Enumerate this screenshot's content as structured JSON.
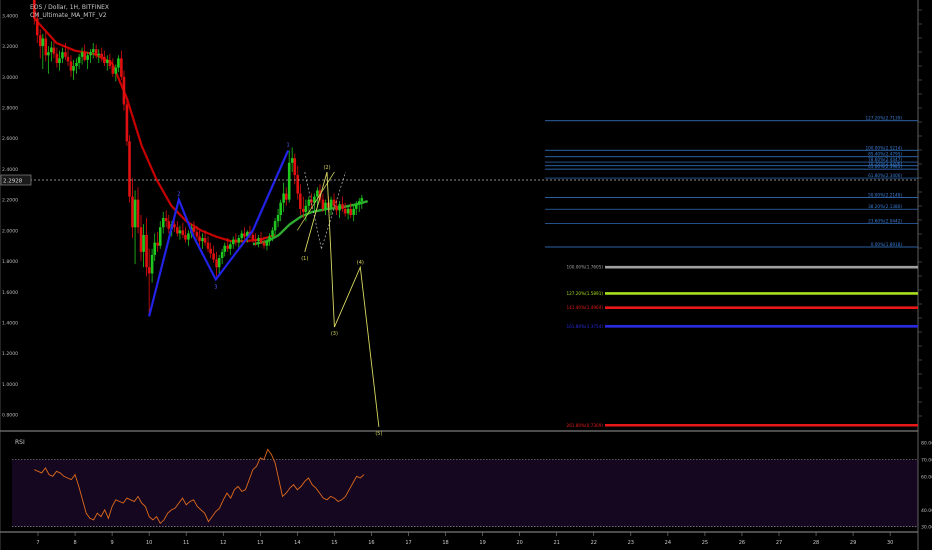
{
  "legend": {
    "line1": "EOS / Dollar, 1H, BITFINEX",
    "line2": "CM_Ultimate_MA_MTF_V2"
  },
  "rsi_label": "RSI",
  "price_tag": "2.2928",
  "colors": {
    "background": "#000000",
    "up_candle": "#1ec81e",
    "down_candle": "#e01010",
    "ma_red": "#c80000",
    "ma_green": "#2eaa2e",
    "pattern": "#2222e8",
    "wave": "#d8d860",
    "fib_line": "#3a7fd8",
    "rsi_line": "#e06a1a",
    "rsi_band": "#160720"
  },
  "chart_data": [
    {
      "type": "candlestick",
      "name": "EOS / Dollar, 1H",
      "y_axis_ticks": [
        "3.4000",
        "3.2000",
        "3.0000",
        "2.8000",
        "2.6000",
        "2.4000",
        "2.2000",
        "2.0000",
        "1.8000",
        "1.6000",
        "1.4000",
        "1.2000",
        "1.0000",
        "0.8000"
      ],
      "ylim": [
        0.7,
        3.5
      ],
      "x_axis_ticks": [
        "7",
        "8",
        "9",
        "10",
        "11",
        "12",
        "13",
        "14",
        "15",
        "16",
        "17",
        "18",
        "19",
        "20",
        "21",
        "22",
        "23",
        "24",
        "25",
        "26",
        "27",
        "28",
        "29",
        "30"
      ],
      "candles": [
        [
          6.9,
          3.5,
          3.52,
          3.34,
          3.38
        ],
        [
          6.98,
          3.38,
          3.42,
          3.22,
          3.27
        ],
        [
          7.06,
          3.27,
          3.31,
          3.12,
          3.2
        ],
        [
          7.13,
          3.2,
          3.28,
          3.05,
          3.25
        ],
        [
          7.21,
          3.25,
          3.29,
          3.1,
          3.14
        ],
        [
          7.28,
          3.14,
          3.2,
          3.02,
          3.16
        ],
        [
          7.36,
          3.16,
          3.23,
          3.1,
          3.19
        ],
        [
          7.43,
          3.19,
          3.23,
          3.12,
          3.15
        ],
        [
          7.51,
          3.15,
          3.19,
          3.06,
          3.09
        ],
        [
          7.58,
          3.09,
          3.17,
          3.04,
          3.12
        ],
        [
          7.66,
          3.12,
          3.19,
          3.09,
          3.16
        ],
        [
          7.74,
          3.16,
          3.22,
          3.11,
          3.13
        ],
        [
          7.81,
          3.13,
          3.18,
          3.07,
          3.1
        ],
        [
          7.89,
          3.1,
          3.14,
          3.0,
          3.04
        ],
        [
          7.96,
          3.04,
          3.11,
          2.98,
          3.07
        ],
        [
          8.04,
          3.07,
          3.12,
          3.02,
          3.09
        ],
        [
          8.11,
          3.09,
          3.15,
          3.05,
          3.13
        ],
        [
          8.19,
          3.13,
          3.19,
          3.08,
          3.16
        ],
        [
          8.26,
          3.16,
          3.21,
          3.1,
          3.11
        ],
        [
          8.34,
          3.11,
          3.16,
          3.05,
          3.14
        ],
        [
          8.42,
          3.14,
          3.18,
          3.09,
          3.16
        ],
        [
          8.49,
          3.16,
          3.22,
          3.12,
          3.18
        ],
        [
          8.57,
          3.18,
          3.21,
          3.12,
          3.14
        ],
        [
          8.64,
          3.14,
          3.18,
          3.09,
          3.15
        ],
        [
          8.72,
          3.15,
          3.19,
          3.1,
          3.13
        ],
        [
          8.79,
          3.13,
          3.17,
          3.07,
          3.09
        ],
        [
          8.87,
          3.09,
          3.14,
          3.04,
          3.11
        ],
        [
          8.94,
          3.11,
          3.15,
          3.05,
          3.07
        ],
        [
          9.02,
          3.07,
          3.12,
          3.0,
          3.02
        ],
        [
          9.1,
          3.02,
          3.08,
          2.97,
          3.06
        ],
        [
          9.17,
          3.06,
          3.14,
          3.03,
          3.12
        ],
        [
          9.25,
          3.12,
          3.17,
          2.98,
          3.0
        ],
        [
          9.32,
          3.0,
          3.04,
          2.78,
          2.82
        ],
        [
          9.4,
          2.82,
          2.86,
          2.55,
          2.58
        ],
        [
          9.47,
          2.58,
          2.62,
          2.18,
          2.22
        ],
        [
          9.55,
          2.22,
          2.34,
          1.95,
          2.02
        ],
        [
          9.62,
          2.02,
          2.26,
          1.78,
          2.2
        ],
        [
          9.7,
          2.2,
          2.28,
          1.98,
          2.02
        ],
        [
          9.78,
          2.02,
          2.1,
          1.8,
          1.86
        ],
        [
          9.85,
          1.86,
          2.04,
          1.76,
          1.97
        ],
        [
          9.93,
          1.97,
          2.08,
          1.7,
          1.76
        ],
        [
          10.0,
          1.76,
          1.88,
          1.44,
          1.72
        ],
        [
          10.08,
          1.72,
          1.88,
          1.66,
          1.84
        ],
        [
          10.15,
          1.84,
          1.98,
          1.8,
          1.92
        ],
        [
          10.23,
          1.92,
          1.99,
          1.86,
          1.9
        ],
        [
          10.3,
          1.9,
          2.06,
          1.88,
          2.02
        ],
        [
          10.38,
          2.02,
          2.12,
          1.98,
          2.08
        ],
        [
          10.46,
          2.08,
          2.13,
          2.02,
          2.06
        ],
        [
          10.53,
          2.06,
          2.1,
          1.98,
          2.01
        ],
        [
          10.61,
          2.01,
          2.06,
          1.96,
          2.04
        ],
        [
          10.68,
          2.04,
          2.08,
          1.99,
          2.02
        ],
        [
          10.76,
          2.02,
          2.06,
          1.96,
          1.98
        ],
        [
          10.83,
          1.98,
          2.03,
          1.94,
          2.0
        ],
        [
          10.91,
          2.0,
          2.05,
          1.95,
          1.97
        ],
        [
          10.98,
          1.97,
          2.02,
          1.92,
          1.94
        ],
        [
          11.06,
          1.94,
          2.0,
          1.9,
          1.98
        ],
        [
          11.14,
          1.98,
          2.04,
          1.95,
          2.02
        ],
        [
          11.21,
          2.02,
          2.06,
          1.97,
          1.99
        ],
        [
          11.29,
          1.99,
          2.03,
          1.94,
          1.96
        ],
        [
          11.36,
          1.96,
          2.0,
          1.9,
          1.93
        ],
        [
          11.44,
          1.93,
          1.98,
          1.88,
          1.95
        ],
        [
          11.51,
          1.95,
          2.0,
          1.9,
          1.92
        ],
        [
          11.59,
          1.92,
          1.96,
          1.86,
          1.88
        ],
        [
          11.66,
          1.88,
          1.92,
          1.82,
          1.85
        ],
        [
          11.74,
          1.85,
          1.9,
          1.79,
          1.81
        ],
        [
          11.82,
          1.81,
          1.86,
          1.7,
          1.76
        ],
        [
          11.89,
          1.76,
          1.84,
          1.72,
          1.82
        ],
        [
          11.97,
          1.82,
          1.88,
          1.78,
          1.86
        ],
        [
          12.04,
          1.86,
          1.92,
          1.83,
          1.9
        ],
        [
          12.12,
          1.9,
          1.95,
          1.86,
          1.88
        ],
        [
          12.19,
          1.88,
          1.93,
          1.84,
          1.91
        ],
        [
          12.27,
          1.91,
          1.96,
          1.88,
          1.94
        ],
        [
          12.34,
          1.94,
          1.98,
          1.9,
          1.92
        ],
        [
          12.42,
          1.92,
          1.97,
          1.88,
          1.95
        ],
        [
          12.5,
          1.95,
          2.0,
          1.92,
          1.98
        ],
        [
          12.57,
          1.98,
          2.02,
          1.94,
          1.96
        ],
        [
          12.65,
          1.96,
          2.0,
          1.92,
          1.99
        ],
        [
          12.72,
          1.99,
          2.03,
          1.95,
          1.97
        ],
        [
          12.8,
          1.97,
          2.01,
          1.92,
          1.94
        ],
        [
          12.87,
          1.94,
          1.98,
          1.9,
          1.93
        ],
        [
          12.95,
          1.93,
          1.97,
          1.89,
          1.95
        ],
        [
          13.02,
          1.95,
          1.99,
          1.91,
          1.92
        ],
        [
          13.1,
          1.92,
          1.96,
          1.88,
          1.9
        ],
        [
          13.18,
          1.9,
          1.95,
          1.87,
          1.93
        ],
        [
          13.25,
          1.93,
          1.98,
          1.9,
          1.96
        ],
        [
          13.33,
          1.96,
          2.02,
          1.93,
          2.0
        ],
        [
          13.4,
          2.0,
          2.08,
          1.97,
          2.06
        ],
        [
          13.48,
          2.06,
          2.14,
          2.02,
          2.1
        ],
        [
          13.55,
          2.1,
          2.2,
          2.06,
          2.18
        ],
        [
          13.63,
          2.18,
          2.31,
          2.12,
          2.24
        ],
        [
          13.7,
          2.24,
          2.28,
          2.16,
          2.2
        ],
        [
          13.78,
          2.2,
          2.52,
          2.18,
          2.44
        ],
        [
          13.86,
          2.44,
          2.54,
          2.38,
          2.47
        ],
        [
          13.93,
          2.47,
          2.5,
          2.3,
          2.36
        ],
        [
          14.01,
          2.36,
          2.42,
          2.2,
          2.24
        ],
        [
          14.08,
          2.24,
          2.3,
          2.1,
          2.14
        ],
        [
          14.16,
          2.14,
          2.22,
          2.08,
          2.12
        ],
        [
          14.23,
          2.12,
          2.2,
          2.06,
          2.16
        ],
        [
          14.31,
          2.16,
          2.22,
          2.12,
          2.2
        ],
        [
          14.38,
          2.2,
          2.24,
          2.14,
          2.18
        ],
        [
          14.46,
          2.18,
          2.24,
          2.12,
          2.22
        ],
        [
          14.54,
          2.22,
          2.28,
          2.16,
          2.26
        ],
        [
          14.61,
          2.26,
          2.3,
          2.18,
          2.2
        ],
        [
          14.69,
          2.2,
          2.24,
          2.12,
          2.14
        ],
        [
          14.76,
          2.14,
          2.2,
          2.1,
          2.18
        ],
        [
          14.84,
          2.18,
          2.22,
          2.12,
          2.15
        ],
        [
          14.91,
          2.15,
          2.22,
          2.1,
          2.2
        ],
        [
          14.99,
          2.2,
          2.24,
          2.14,
          2.16
        ],
        [
          15.06,
          2.16,
          2.2,
          2.1,
          2.13
        ],
        [
          15.14,
          2.13,
          2.19,
          2.08,
          2.17
        ],
        [
          15.22,
          2.17,
          2.22,
          2.12,
          2.14
        ],
        [
          15.29,
          2.14,
          2.18,
          2.09,
          2.11
        ],
        [
          15.37,
          2.11,
          2.16,
          2.07,
          2.14
        ],
        [
          15.44,
          2.14,
          2.18,
          2.08,
          2.1
        ],
        [
          15.52,
          2.1,
          2.16,
          2.06,
          2.14
        ],
        [
          15.59,
          2.14,
          2.19,
          2.1,
          2.17
        ],
        [
          15.67,
          2.17,
          2.21,
          2.12,
          2.19
        ],
        [
          15.74,
          2.19,
          2.23,
          2.14,
          2.21
        ]
      ],
      "ma_red": [
        [
          6.9,
          3.38
        ],
        [
          7.5,
          3.22
        ],
        [
          8.0,
          3.17
        ],
        [
          8.5,
          3.15
        ],
        [
          9.0,
          3.09
        ],
        [
          9.4,
          2.86
        ],
        [
          9.8,
          2.55
        ],
        [
          10.2,
          2.33
        ],
        [
          10.6,
          2.16
        ],
        [
          11.0,
          2.06
        ],
        [
          11.4,
          2.0
        ],
        [
          11.8,
          1.96
        ],
        [
          12.2,
          1.93
        ],
        [
          12.6,
          1.93
        ],
        [
          13.0,
          1.94
        ],
        [
          13.4,
          1.97
        ]
      ],
      "ma_green": [
        [
          12.8,
          1.91
        ],
        [
          13.2,
          1.93
        ],
        [
          13.5,
          1.97
        ],
        [
          13.8,
          2.04
        ],
        [
          14.1,
          2.09
        ],
        [
          14.4,
          2.12
        ],
        [
          14.8,
          2.14
        ],
        [
          15.2,
          2.15
        ],
        [
          15.6,
          2.17
        ],
        [
          15.9,
          2.19
        ]
      ],
      "pattern_points": [
        [
          10.0,
          1.44,
          ""
        ],
        [
          10.8,
          2.2,
          "2"
        ],
        [
          11.2,
          1.96,
          ""
        ],
        [
          11.8,
          1.68,
          "3"
        ],
        [
          12.8,
          2.0,
          ""
        ],
        [
          13.75,
          2.52,
          "1"
        ]
      ],
      "fib_levels": [
        {
          "label": "127.20%(2.7139)",
          "value": 2.7139
        },
        {
          "label": "100.00%(2.5214)",
          "value": 2.5214
        },
        {
          "label": "85.40%(2.4795)",
          "value": 2.4795
        },
        {
          "label": "78.60%(2.4447)",
          "value": 2.4447
        },
        {
          "label": "70.70%(2.4206)",
          "value": 2.4206
        },
        {
          "label": "65.00%(2.3985)",
          "value": 2.3985
        },
        {
          "label": "61.80%(2.3406)",
          "value": 2.3406
        },
        {
          "label": "50.00%(2.2148)",
          "value": 2.2148
        },
        {
          "label": "38.20%(2.1380)",
          "value": 2.138
        },
        {
          "label": "23.60%(2.0442)",
          "value": 2.0442
        },
        {
          "label": "0.00%(1.8918)",
          "value": 1.8918
        }
      ],
      "projection_levels": [
        {
          "label": "100.00%(1.7605)",
          "value": 1.7605,
          "color": "#a0a0a0"
        },
        {
          "label": "127.20%(1.5891)",
          "value": 1.5891,
          "color": "#a8e020"
        },
        {
          "label": "141.40%(1.4964)",
          "value": 1.4964,
          "color": "#e81818"
        },
        {
          "label": "161.80%(1.3754)",
          "value": 1.3754,
          "color": "#2a2ae0"
        },
        {
          "label": "261.80%(0.7309)",
          "value": 0.7309,
          "color": "#e81818"
        }
      ],
      "wave_points": [
        [
          14.2,
          1.86,
          "(1)"
        ],
        [
          14.8,
          2.38,
          "(2)"
        ],
        [
          15.0,
          1.37,
          "(3)"
        ],
        [
          15.7,
          1.76,
          "(4)"
        ],
        [
          16.2,
          0.72,
          "(5)"
        ]
      ]
    },
    {
      "type": "line",
      "name": "RSI",
      "y_axis_ticks": [
        "80.00",
        "70.00",
        "60.00",
        "40.00",
        "30.00"
      ],
      "ylim": [
        28,
        84
      ],
      "bands": [
        70,
        30
      ],
      "x": [
        6.9,
        7.0,
        7.1,
        7.2,
        7.3,
        7.4,
        7.5,
        7.6,
        7.7,
        7.8,
        7.9,
        8.0,
        8.1,
        8.2,
        8.3,
        8.4,
        8.5,
        8.6,
        8.7,
        8.8,
        8.9,
        9.0,
        9.1,
        9.2,
        9.3,
        9.4,
        9.5,
        9.6,
        9.7,
        9.8,
        9.9,
        10.0,
        10.1,
        10.2,
        10.3,
        10.4,
        10.5,
        10.6,
        10.7,
        10.8,
        10.9,
        11.0,
        11.1,
        11.2,
        11.3,
        11.4,
        11.5,
        11.6,
        11.7,
        11.8,
        11.9,
        12.0,
        12.1,
        12.2,
        12.3,
        12.4,
        12.5,
        12.6,
        12.7,
        12.8,
        12.9,
        13.0,
        13.1,
        13.2,
        13.3,
        13.4,
        13.5,
        13.6,
        13.7,
        13.8,
        13.9,
        14.0,
        14.1,
        14.2,
        14.3,
        14.4,
        14.5,
        14.6,
        14.7,
        14.8,
        14.9,
        15.0,
        15.1,
        15.2,
        15.3,
        15.4,
        15.5,
        15.6,
        15.7,
        15.8
      ],
      "values": [
        64,
        63,
        62,
        65,
        61,
        60,
        63,
        62,
        60,
        59,
        58,
        61,
        54,
        46,
        38,
        35,
        34,
        38,
        36,
        40,
        35,
        42,
        46,
        45,
        44,
        47,
        46,
        45,
        48,
        44,
        42,
        36,
        34,
        36,
        32,
        34,
        38,
        40,
        41,
        44,
        47,
        43,
        45,
        46,
        42,
        40,
        38,
        33,
        36,
        39,
        41,
        46,
        50,
        47,
        52,
        54,
        51,
        52,
        58,
        64,
        66,
        71,
        70,
        76,
        73,
        68,
        58,
        48,
        50,
        53,
        55,
        52,
        54,
        57,
        59,
        55,
        53,
        50,
        47,
        46,
        48,
        47,
        45,
        46,
        48,
        52,
        56,
        60,
        59,
        61
      ]
    }
  ]
}
